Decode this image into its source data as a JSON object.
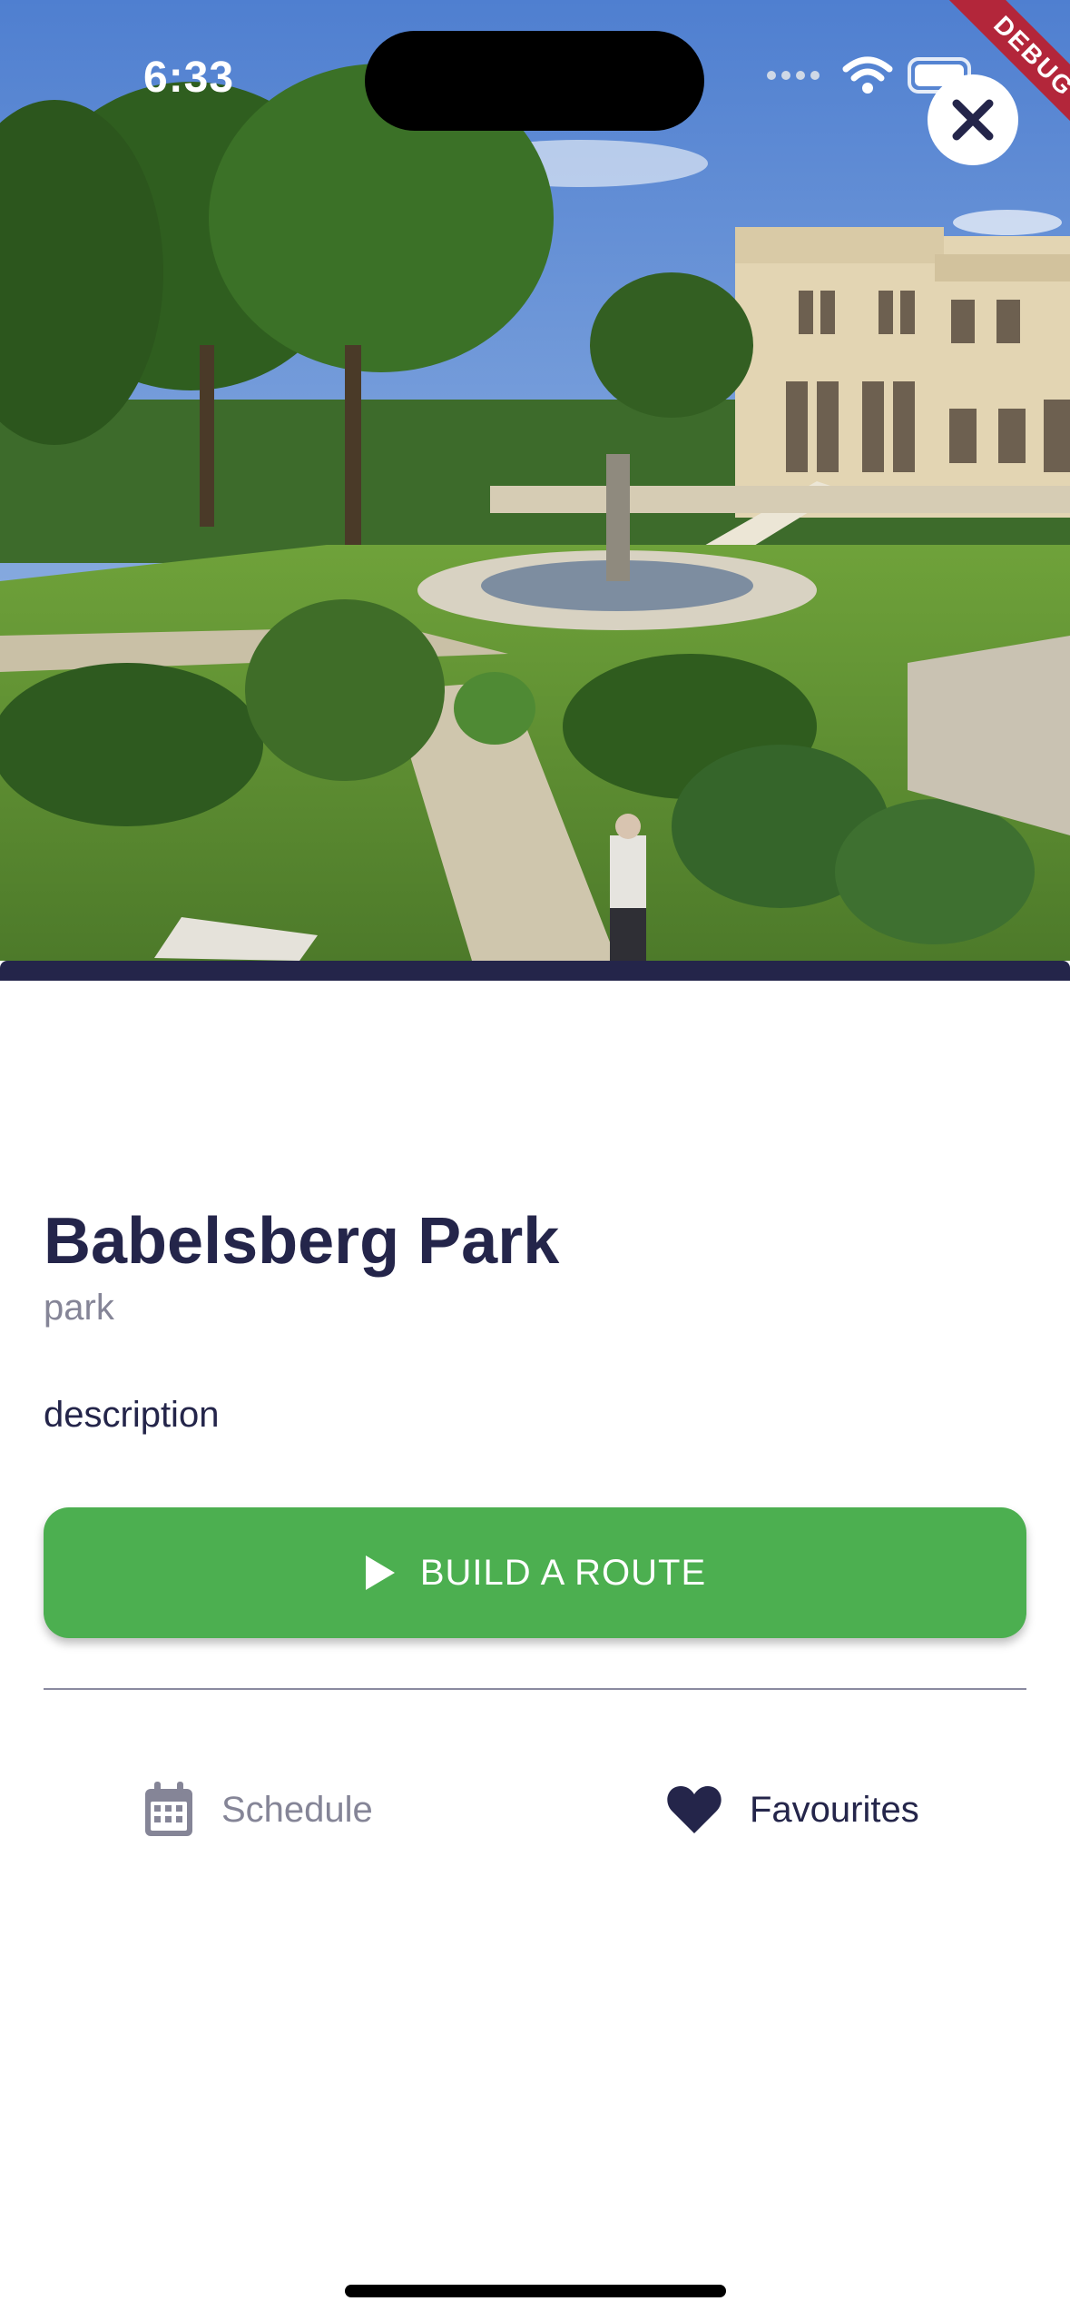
{
  "status_bar": {
    "time": "6:33"
  },
  "debug_banner": "DEBUG",
  "hero": {
    "image_desc": "photo-park-castle",
    "close_icon": "close-icon"
  },
  "place": {
    "title": "Babelsberg Park",
    "category": "park",
    "description_label": "description"
  },
  "actions": {
    "build_route": "BUILD A ROUTE",
    "schedule": "Schedule",
    "favourites": "Favourites"
  },
  "colors": {
    "primary": "#24254a",
    "accent_green": "#4caf50",
    "muted": "#858597",
    "debug_red": "#b3263a"
  }
}
